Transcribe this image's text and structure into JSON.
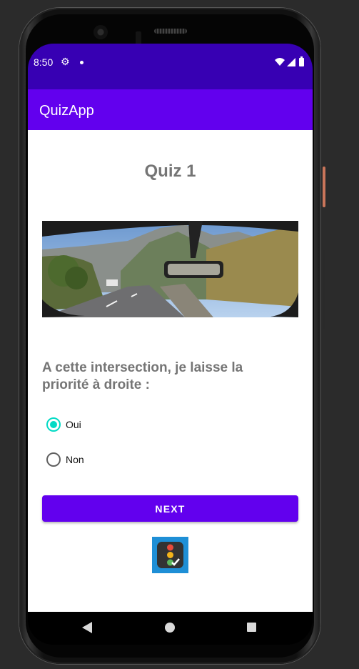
{
  "status_bar": {
    "time": "8:50",
    "gear_icon": "settings-gear",
    "icons": [
      "notification-dot",
      "wifi",
      "cellular-signal",
      "battery"
    ]
  },
  "app_bar": {
    "title": "QuizApp"
  },
  "quiz": {
    "title": "Quiz 1",
    "image_icon": "road-intersection-photo",
    "question": "A cette intersection, je laisse la priorité à droite :",
    "options": [
      {
        "label": "Oui",
        "checked": true
      },
      {
        "label": "Non",
        "checked": false
      }
    ],
    "next_button": "NEXT",
    "logo_icon": "traffic-light-check-logo"
  },
  "nav_bar": {
    "icons": [
      "back-triangle",
      "home-circle",
      "recents-square"
    ]
  },
  "colors": {
    "status_bar": "#3700b3",
    "app_bar": "#6200ee",
    "accent": "#03dac5",
    "text_gray": "#757575",
    "button": "#6200ee"
  }
}
